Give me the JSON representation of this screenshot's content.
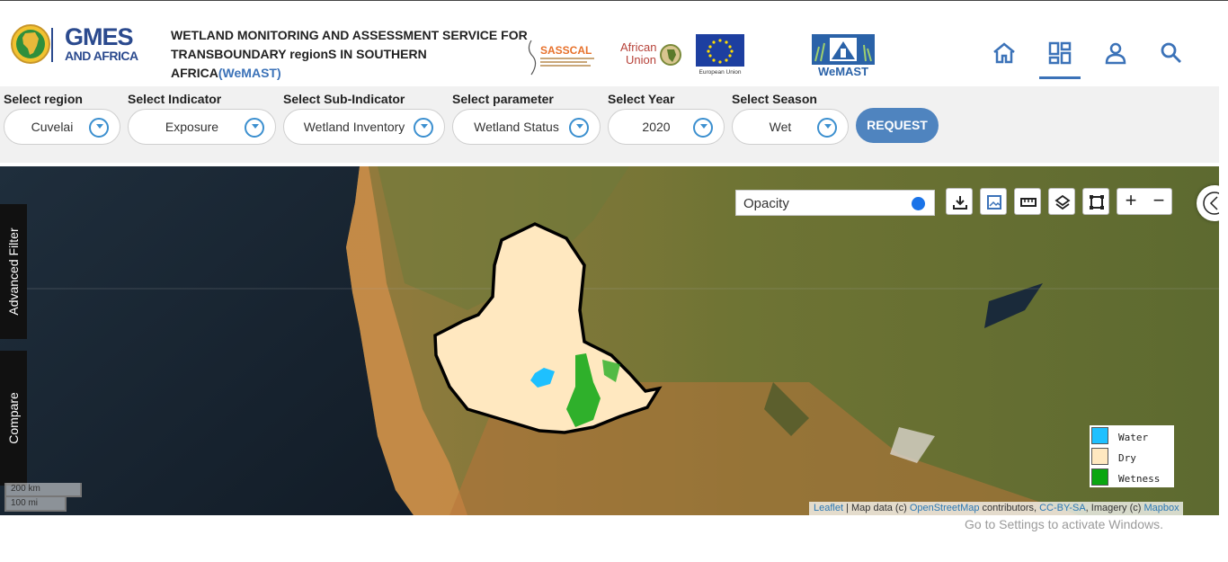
{
  "header": {
    "logo_line1": "GMES",
    "logo_line2": "AND AFRICA",
    "title_line1": "WETLAND MONITORING AND ASSESSMENT SERVICE FOR",
    "title_line2": "TRANSBOUNDARY regionS IN SOUTHERN AFRICA",
    "title_acronym": "(WeMAST)",
    "partners": {
      "sasscal": "SASSCAL",
      "au_line1": "African",
      "au_line2": "Union",
      "eu": "European Union",
      "wemast": "WeMAST"
    },
    "nav_icons": [
      "home-icon",
      "dashboard-icon",
      "user-icon",
      "search-icon"
    ]
  },
  "filters": {
    "region": {
      "label": "Select region",
      "value": "Cuvelai"
    },
    "indicator": {
      "label": "Select Indicator",
      "value": "Exposure"
    },
    "sub_indicator": {
      "label": "Select Sub-Indicator",
      "value": "Wetland Inventory"
    },
    "parameter": {
      "label": "Select parameter",
      "value": "Wetland Status"
    },
    "year": {
      "label": "Select Year",
      "value": "2020"
    },
    "season": {
      "label": "Select Season",
      "value": "Wet"
    },
    "request_label": "REQUEST"
  },
  "map": {
    "opacity_label": "Opacity",
    "opacity_value": 1.0,
    "tools": [
      "download-icon",
      "image-icon",
      "ruler-icon",
      "layers-icon",
      "draw-rectangle-icon"
    ],
    "zoom_in": "+",
    "zoom_out": "−",
    "side_tabs": {
      "advanced_filter": "Advanced Filter",
      "compare": "Compare"
    },
    "legend": [
      {
        "label": "Water",
        "color": "#1ec0ff"
      },
      {
        "label": "Dry",
        "color": "#ffe8c0"
      },
      {
        "label": "Wetness",
        "color": "#0aa610"
      }
    ],
    "scale": {
      "km": "200 km",
      "mi": "100 mi"
    },
    "attribution": {
      "leaflet": "Leaflet",
      "sep1": " | Map data (c) ",
      "osm": "OpenStreetMap",
      "sep2": " contributors, ",
      "license": "CC-BY-SA",
      "sep3": ", Imagery (c) ",
      "mapbox": "Mapbox"
    }
  },
  "watermark": "Go to Settings to activate Windows."
}
